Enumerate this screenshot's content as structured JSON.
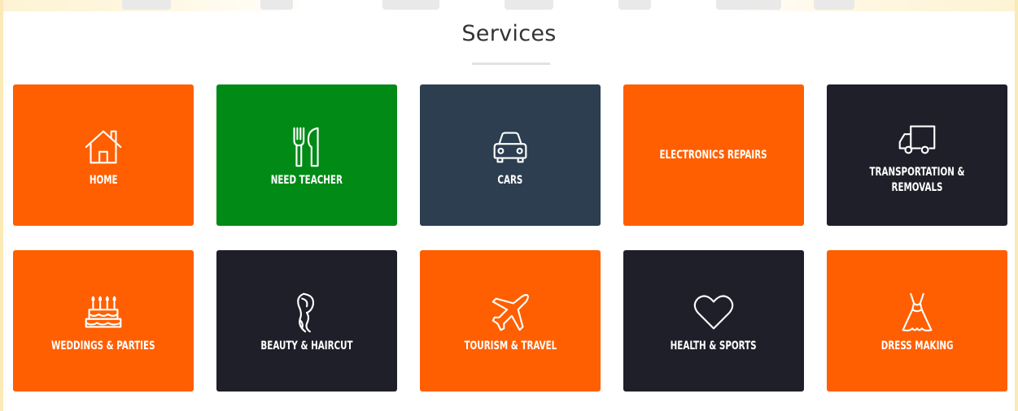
{
  "section": {
    "title": "Services"
  },
  "colors": {
    "orange": "#ff5f00",
    "green": "#028a16",
    "slate": "#2c3e50",
    "dark": "#1e1f29"
  },
  "services": [
    {
      "label": "HOME",
      "icon": "home-icon",
      "color": "#ff5f00"
    },
    {
      "label": "NEED TEACHER",
      "icon": "fork-knife-icon",
      "color": "#028a16"
    },
    {
      "label": "CARS",
      "icon": "car-icon",
      "color": "#2c3e50"
    },
    {
      "label": "ELECTRONICS REPAIRS",
      "icon": "",
      "color": "#ff5f00"
    },
    {
      "label": "TRANSPORTATION & REMOVALS",
      "icon": "truck-icon",
      "color": "#1e1f29"
    },
    {
      "label": "WEDDINGS & PARTIES",
      "icon": "cake-icon",
      "color": "#ff5f00"
    },
    {
      "label": "BEAUTY & HAIRCUT",
      "icon": "hair-icon",
      "color": "#1e1f29"
    },
    {
      "label": "TOURISM & TRAVEL",
      "icon": "airplane-icon",
      "color": "#ff5f00"
    },
    {
      "label": "HEALTH & SPORTS",
      "icon": "heart-icon",
      "color": "#1e1f29"
    },
    {
      "label": "DRESS MAKING",
      "icon": "dress-icon",
      "color": "#ff5f00"
    }
  ]
}
